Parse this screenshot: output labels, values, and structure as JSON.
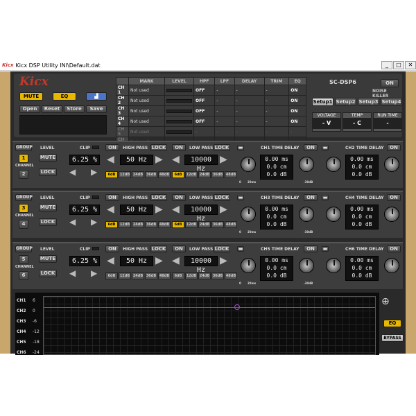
{
  "window": {
    "title": "Kicx DSP Utility  INI\\Default.dat",
    "logo": "Kicx",
    "controls": [
      "_",
      "□",
      "✕"
    ]
  },
  "header": {
    "logo": "Kicx",
    "mute": "MUTE",
    "eq": "EQ",
    "file": [
      "Open",
      "Reset",
      "Store",
      "Save"
    ],
    "cols": [
      "MARK",
      "LEVEL",
      "HPF",
      "LPF",
      "DELAY",
      "TRIM",
      "EQ"
    ],
    "channels": [
      {
        "ch": "CH 1",
        "mark": "Not used",
        "hpf": "OFF",
        "lpf": "-",
        "delay": "-",
        "trim": "-",
        "eq": "ON"
      },
      {
        "ch": "CH 2",
        "mark": "Not used",
        "hpf": "OFF",
        "lpf": "-",
        "delay": "-",
        "trim": "-",
        "eq": "ON"
      },
      {
        "ch": "CH 3",
        "mark": "Not used",
        "hpf": "OFF",
        "lpf": "-",
        "delay": "-",
        "trim": "-",
        "eq": "ON"
      },
      {
        "ch": "CH 4",
        "mark": "Not used",
        "hpf": "OFF",
        "lpf": "-",
        "delay": "-",
        "trim": "-",
        "eq": "ON"
      },
      {
        "ch": "CH 5",
        "mark": "Not used",
        "hpf": "-",
        "lpf": "-",
        "delay": "-",
        "trim": "-",
        "eq": "-"
      },
      {
        "ch": "CH 6",
        "mark": "Not used",
        "hpf": "-",
        "lpf": "-",
        "delay": "-",
        "trim": "-",
        "eq": "-"
      }
    ],
    "device": "SC-DSP6",
    "on": "ON",
    "noise_killer": "NOISE KILLER",
    "setups": [
      "Setup1",
      "Setup2",
      "Setup3",
      "Setup4"
    ],
    "voltage_label": "VOLTAGE",
    "voltage": "- V",
    "temp_label": "TEMP",
    "temp": "- C",
    "runtime_label": "RUN TIME",
    "runtime": "-"
  },
  "groups": [
    {
      "group": "GROUP",
      "ch_a": "1",
      "ch_b": "2",
      "channel": "CHANNEL",
      "level": "LEVEL",
      "clip": "CLIP",
      "mute": "MUTE",
      "lock": "LOCK",
      "level_val": "6.25 %",
      "hp_on": "ON",
      "hp_label": "HIGH PASS",
      "hp_lock": "LOCK",
      "hp_val": "50 Hz",
      "lp_on": "ON",
      "lp_label": "LOW PASS",
      "lp_lock": "LOCK",
      "lp_val": "10000 Hz",
      "slopes": [
        "6dB",
        "12dB",
        "24dB",
        "36dB",
        "48dB"
      ],
      "td_a": "CH1 TIME DELAY",
      "td_b": "CH2 TIME DELAY",
      "td_on": "ON",
      "ms": "0.00",
      "cm": "0.0",
      "db": "0.0",
      "u_ms": "ms",
      "u_cm": "cm",
      "u_db": "dB",
      "k0": "0",
      "k20": "20ms",
      "kneg": "-30dB"
    },
    {
      "group": "GROUP",
      "ch_a": "3",
      "ch_b": "4",
      "channel": "CHANNEL",
      "level": "LEVEL",
      "clip": "CLIP",
      "mute": "MUTE",
      "lock": "LOCK",
      "level_val": "6.25 %",
      "hp_on": "ON",
      "hp_label": "HIGH PASS",
      "hp_lock": "LOCK",
      "hp_val": "50 Hz",
      "lp_on": "ON",
      "lp_label": "LOW PASS",
      "lp_lock": "LOCK",
      "lp_val": "10000 Hz",
      "slopes": [
        "6dB",
        "12dB",
        "24dB",
        "36dB",
        "48dB"
      ],
      "td_a": "CH3 TIME DELAY",
      "td_b": "CH4 TIME DELAY",
      "td_on": "ON",
      "ms": "0.00",
      "cm": "0.0",
      "db": "0.0",
      "u_ms": "ms",
      "u_cm": "cm",
      "u_db": "dB",
      "k0": "0",
      "k20": "20ms",
      "kneg": "-30dB"
    },
    {
      "group": "GROUP",
      "ch_a": "5",
      "ch_b": "6",
      "channel": "CHANNEL",
      "level": "LEVEL",
      "clip": "CLIP",
      "mute": "MUTE",
      "lock": "LOCK",
      "level_val": "6.25 %",
      "hp_on": "ON",
      "hp_label": "HIGH PASS",
      "hp_lock": "LOCK",
      "hp_val": "50 Hz",
      "lp_on": "ON",
      "lp_label": "LOW PASS",
      "lp_lock": "LOCK",
      "lp_val": "10000 Hz",
      "slopes": [
        "6dB",
        "12dB",
        "24dB",
        "36dB",
        "48dB"
      ],
      "td_a": "CH5 TIME DELAY",
      "td_b": "CH6 TIME DELAY",
      "td_on": "ON",
      "ms": "0.00",
      "cm": "0.0",
      "db": "0.0",
      "u_ms": "ms",
      "u_cm": "cm",
      "u_db": "dB",
      "k0": "0",
      "k20": "20ms",
      "kneg": "-30dB"
    }
  ],
  "graph": {
    "channels": [
      "CH1",
      "CH2",
      "CH3",
      "CH4",
      "CH5",
      "CH6"
    ],
    "ylabels": [
      "6",
      "0",
      "-6",
      "-12",
      "-18",
      "-24"
    ],
    "eq": "EQ",
    "bypass": "BYPASS",
    "zoom": "zoom-icon"
  }
}
